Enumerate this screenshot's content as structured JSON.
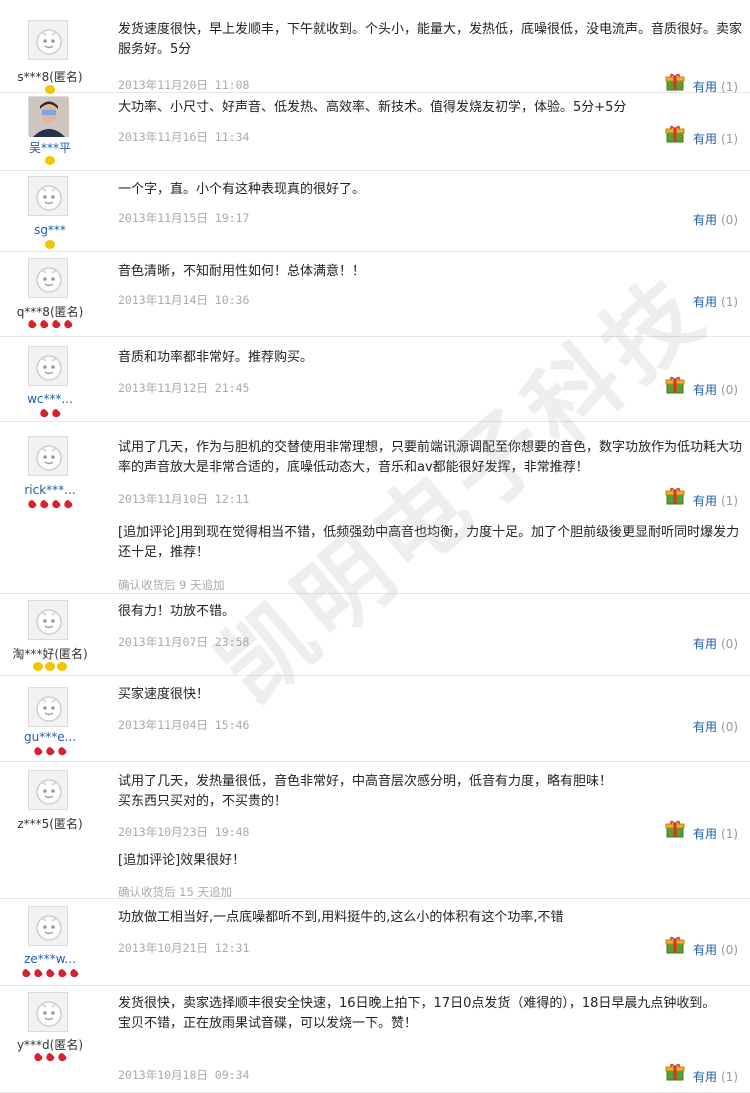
{
  "watermark": "凯明电子科技",
  "helpful_label": "有用",
  "append_prefix": "[追加评论]",
  "reviews": [
    {
      "user": "s***8(匿名)",
      "anonymous": true,
      "badge": "gold",
      "badge_count": 1,
      "text": "发货速度很快，早上发顺丰，下午就收到。个头小，能量大，发热低，底噪很低，没电流声。音质很好。卖家服务好。5分",
      "date": "2013年11月20日 11:08",
      "gift": true,
      "helpful_count": "(1)"
    },
    {
      "user": "吴***平",
      "anonymous": false,
      "photo": true,
      "badge": "gold",
      "badge_count": 1,
      "text": "大功率、小尺寸、好声音、低发热、高效率、新技术。值得发烧友初学，体验。5分+5分",
      "date": "2013年11月16日 11:34",
      "gift": true,
      "helpful_count": "(1)"
    },
    {
      "user": "sg***",
      "anonymous": false,
      "badge": "gold",
      "badge_count": 1,
      "text": "一个字，直。小个有这种表现真的很好了。",
      "date": "2013年11月15日 19:17",
      "gift": false,
      "helpful_count": "(0)"
    },
    {
      "user": "q***8(匿名)",
      "anonymous": true,
      "badge": "red",
      "badge_count": 4,
      "text": "音色清晰，不知耐用性如何！总体满意！！",
      "date": "2013年11月14日 10:36",
      "gift": false,
      "helpful_count": "(1)"
    },
    {
      "user": "wc***...",
      "anonymous": false,
      "badge": "red",
      "badge_count": 2,
      "text": "音质和功率都非常好。推荐购买。",
      "date": "2013年11月12日 21:45",
      "gift": true,
      "helpful_count": "(0)"
    },
    {
      "user": "rick***...",
      "anonymous": false,
      "badge": "red",
      "badge_count": 4,
      "text": "试用了几天，作为与胆机的交替使用非常理想，只要前端讯源调配至你想要的音色，数字功放作为低功耗大功率的声音放大是非常合适的，底噪低动态大，音乐和av都能很好发挥，非常推荐！",
      "date": "2013年11月10日 12:11",
      "gift": true,
      "helpful_count": "(1)",
      "append": "用到现在觉得相当不错，低频强劲中高音也均衡，力度十足。加了个胆前级後更显耐听同时爆发力还十足，推荐！",
      "append_note": "确认收货后 9 天追加"
    },
    {
      "user": "淘***好(匿名)",
      "anonymous": true,
      "badge": "gold",
      "badge_count": 3,
      "text": "很有力！功放不错。",
      "date": "2013年11月07日 23:58",
      "gift": false,
      "helpful_count": "(0)"
    },
    {
      "user": "gu***e...",
      "anonymous": false,
      "badge": "red",
      "badge_count": 3,
      "text": "买家速度很快！",
      "date": "2013年11月04日 15:46",
      "gift": false,
      "helpful_count": "(0)"
    },
    {
      "user": "z***5(匿名)",
      "anonymous": true,
      "badge": "none",
      "badge_count": 0,
      "text": "试用了几天，发热量很低，音色非常好，中高音层次感分明，低音有力度，略有胆味！\n买东西只买对的，不买贵的！",
      "date": "2013年10月23日 19:48",
      "gift": true,
      "helpful_count": "(1)",
      "append": "效果很好！",
      "append_note": "确认收货后 15 天追加"
    },
    {
      "user": "ze***w...",
      "anonymous": false,
      "badge": "red",
      "badge_count": 5,
      "text": "功放做工相当好,一点底噪都听不到,用料挺牛的,这么小的体积有这个功率,不错",
      "date": "2013年10月21日 12:31",
      "gift": true,
      "helpful_count": "(0)"
    },
    {
      "user": "y***d(匿名)",
      "anonymous": true,
      "badge": "red",
      "badge_count": 3,
      "text": "发货很快，卖家选择顺丰很安全快速，16日晚上拍下，17日0点发货（难得的），18日早晨九点钟收到。\n宝贝不错，正在放雨果试音碟，可以发烧一下。赞！",
      "date": "2013年10月18日 09:34",
      "gift": true,
      "helpful_count": "(1)"
    }
  ]
}
